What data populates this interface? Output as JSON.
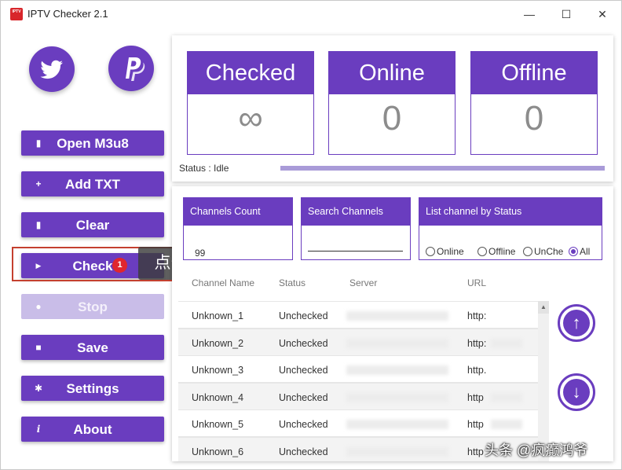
{
  "window": {
    "app_icon_text": "IPTV Checker",
    "title": "IPTV Checker 2.1",
    "controls": {
      "minimize": "—",
      "maximize": "☐",
      "close": "✕"
    }
  },
  "sidebar": {
    "social": [
      {
        "name": "twitter-button",
        "icon": "twitter-bird-icon"
      },
      {
        "name": "paypal-button",
        "icon": "paypal-logo-icon"
      }
    ],
    "buttons": [
      {
        "label": "Open M3u8",
        "icon": "file-icon",
        "glyph": "▮"
      },
      {
        "label": "Add TXT",
        "icon": "plus-icon",
        "glyph": "+"
      },
      {
        "label": "Clear",
        "icon": "trash-icon",
        "glyph": "▮"
      },
      {
        "label": "Check",
        "icon": "play-icon",
        "glyph": "▶"
      },
      {
        "label": "Stop",
        "icon": "stop-icon",
        "glyph": "●",
        "disabled": true
      },
      {
        "label": "Save",
        "icon": "save-icon",
        "glyph": "■"
      },
      {
        "label": "Settings",
        "icon": "gear-icon",
        "glyph": "✱"
      },
      {
        "label": "About",
        "icon": "info-icon",
        "glyph": "i"
      }
    ]
  },
  "annotation": {
    "badge": "1",
    "tooltip": "点击检测"
  },
  "stats": {
    "checked": {
      "label": "Checked",
      "value": "∞"
    },
    "online": {
      "label": "Online",
      "value": "0"
    },
    "offline": {
      "label": "Offline",
      "value": "0"
    },
    "status": "Status : Idle"
  },
  "controls": {
    "channels_count": {
      "label": "Channels Count",
      "value": "99"
    },
    "search": {
      "label": "Search Channels",
      "value": ""
    },
    "filter": {
      "label": "List channel by Status",
      "options": [
        "Online",
        "Offline",
        "UnChe",
        "All"
      ],
      "selected": "All"
    }
  },
  "table": {
    "headers": [
      "Channel Name",
      "Status",
      "Server",
      "URL"
    ],
    "rows": [
      {
        "name": "Unknown_1",
        "status": "Unchecked",
        "url": "http:"
      },
      {
        "name": "Unknown_2",
        "status": "Unchecked",
        "url": "http:"
      },
      {
        "name": "Unknown_3",
        "status": "Unchecked",
        "url": "http."
      },
      {
        "name": "Unknown_4",
        "status": "Unchecked",
        "url": "http"
      },
      {
        "name": "Unknown_5",
        "status": "Unchecked",
        "url": "http"
      },
      {
        "name": "Unknown_6",
        "status": "Unchecked",
        "url": "http"
      }
    ]
  },
  "watermark": "头条 @疯癫鸿爷",
  "colors": {
    "accent": "#6a3dbf",
    "disabled": "#c9bde8",
    "highlight": "#c4402f",
    "badge": "#e0262e"
  }
}
